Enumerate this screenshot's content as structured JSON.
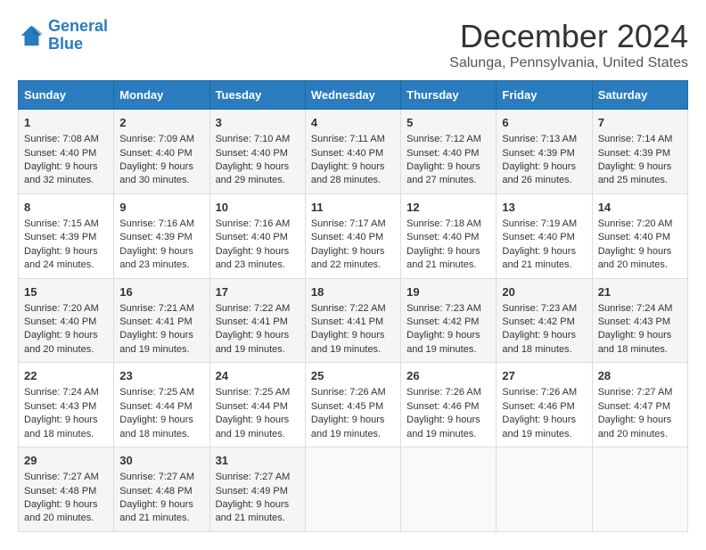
{
  "header": {
    "logo_line1": "General",
    "logo_line2": "Blue",
    "month": "December 2024",
    "location": "Salunga, Pennsylvania, United States"
  },
  "days_of_week": [
    "Sunday",
    "Monday",
    "Tuesday",
    "Wednesday",
    "Thursday",
    "Friday",
    "Saturday"
  ],
  "weeks": [
    [
      {
        "day": "1",
        "sunrise": "Sunrise: 7:08 AM",
        "sunset": "Sunset: 4:40 PM",
        "daylight": "Daylight: 9 hours and 32 minutes."
      },
      {
        "day": "2",
        "sunrise": "Sunrise: 7:09 AM",
        "sunset": "Sunset: 4:40 PM",
        "daylight": "Daylight: 9 hours and 30 minutes."
      },
      {
        "day": "3",
        "sunrise": "Sunrise: 7:10 AM",
        "sunset": "Sunset: 4:40 PM",
        "daylight": "Daylight: 9 hours and 29 minutes."
      },
      {
        "day": "4",
        "sunrise": "Sunrise: 7:11 AM",
        "sunset": "Sunset: 4:40 PM",
        "daylight": "Daylight: 9 hours and 28 minutes."
      },
      {
        "day": "5",
        "sunrise": "Sunrise: 7:12 AM",
        "sunset": "Sunset: 4:40 PM",
        "daylight": "Daylight: 9 hours and 27 minutes."
      },
      {
        "day": "6",
        "sunrise": "Sunrise: 7:13 AM",
        "sunset": "Sunset: 4:39 PM",
        "daylight": "Daylight: 9 hours and 26 minutes."
      },
      {
        "day": "7",
        "sunrise": "Sunrise: 7:14 AM",
        "sunset": "Sunset: 4:39 PM",
        "daylight": "Daylight: 9 hours and 25 minutes."
      }
    ],
    [
      {
        "day": "8",
        "sunrise": "Sunrise: 7:15 AM",
        "sunset": "Sunset: 4:39 PM",
        "daylight": "Daylight: 9 hours and 24 minutes."
      },
      {
        "day": "9",
        "sunrise": "Sunrise: 7:16 AM",
        "sunset": "Sunset: 4:39 PM",
        "daylight": "Daylight: 9 hours and 23 minutes."
      },
      {
        "day": "10",
        "sunrise": "Sunrise: 7:16 AM",
        "sunset": "Sunset: 4:40 PM",
        "daylight": "Daylight: 9 hours and 23 minutes."
      },
      {
        "day": "11",
        "sunrise": "Sunrise: 7:17 AM",
        "sunset": "Sunset: 4:40 PM",
        "daylight": "Daylight: 9 hours and 22 minutes."
      },
      {
        "day": "12",
        "sunrise": "Sunrise: 7:18 AM",
        "sunset": "Sunset: 4:40 PM",
        "daylight": "Daylight: 9 hours and 21 minutes."
      },
      {
        "day": "13",
        "sunrise": "Sunrise: 7:19 AM",
        "sunset": "Sunset: 4:40 PM",
        "daylight": "Daylight: 9 hours and 21 minutes."
      },
      {
        "day": "14",
        "sunrise": "Sunrise: 7:20 AM",
        "sunset": "Sunset: 4:40 PM",
        "daylight": "Daylight: 9 hours and 20 minutes."
      }
    ],
    [
      {
        "day": "15",
        "sunrise": "Sunrise: 7:20 AM",
        "sunset": "Sunset: 4:40 PM",
        "daylight": "Daylight: 9 hours and 20 minutes."
      },
      {
        "day": "16",
        "sunrise": "Sunrise: 7:21 AM",
        "sunset": "Sunset: 4:41 PM",
        "daylight": "Daylight: 9 hours and 19 minutes."
      },
      {
        "day": "17",
        "sunrise": "Sunrise: 7:22 AM",
        "sunset": "Sunset: 4:41 PM",
        "daylight": "Daylight: 9 hours and 19 minutes."
      },
      {
        "day": "18",
        "sunrise": "Sunrise: 7:22 AM",
        "sunset": "Sunset: 4:41 PM",
        "daylight": "Daylight: 9 hours and 19 minutes."
      },
      {
        "day": "19",
        "sunrise": "Sunrise: 7:23 AM",
        "sunset": "Sunset: 4:42 PM",
        "daylight": "Daylight: 9 hours and 19 minutes."
      },
      {
        "day": "20",
        "sunrise": "Sunrise: 7:23 AM",
        "sunset": "Sunset: 4:42 PM",
        "daylight": "Daylight: 9 hours and 18 minutes."
      },
      {
        "day": "21",
        "sunrise": "Sunrise: 7:24 AM",
        "sunset": "Sunset: 4:43 PM",
        "daylight": "Daylight: 9 hours and 18 minutes."
      }
    ],
    [
      {
        "day": "22",
        "sunrise": "Sunrise: 7:24 AM",
        "sunset": "Sunset: 4:43 PM",
        "daylight": "Daylight: 9 hours and 18 minutes."
      },
      {
        "day": "23",
        "sunrise": "Sunrise: 7:25 AM",
        "sunset": "Sunset: 4:44 PM",
        "daylight": "Daylight: 9 hours and 18 minutes."
      },
      {
        "day": "24",
        "sunrise": "Sunrise: 7:25 AM",
        "sunset": "Sunset: 4:44 PM",
        "daylight": "Daylight: 9 hours and 19 minutes."
      },
      {
        "day": "25",
        "sunrise": "Sunrise: 7:26 AM",
        "sunset": "Sunset: 4:45 PM",
        "daylight": "Daylight: 9 hours and 19 minutes."
      },
      {
        "day": "26",
        "sunrise": "Sunrise: 7:26 AM",
        "sunset": "Sunset: 4:46 PM",
        "daylight": "Daylight: 9 hours and 19 minutes."
      },
      {
        "day": "27",
        "sunrise": "Sunrise: 7:26 AM",
        "sunset": "Sunset: 4:46 PM",
        "daylight": "Daylight: 9 hours and 19 minutes."
      },
      {
        "day": "28",
        "sunrise": "Sunrise: 7:27 AM",
        "sunset": "Sunset: 4:47 PM",
        "daylight": "Daylight: 9 hours and 20 minutes."
      }
    ],
    [
      {
        "day": "29",
        "sunrise": "Sunrise: 7:27 AM",
        "sunset": "Sunset: 4:48 PM",
        "daylight": "Daylight: 9 hours and 20 minutes."
      },
      {
        "day": "30",
        "sunrise": "Sunrise: 7:27 AM",
        "sunset": "Sunset: 4:48 PM",
        "daylight": "Daylight: 9 hours and 21 minutes."
      },
      {
        "day": "31",
        "sunrise": "Sunrise: 7:27 AM",
        "sunset": "Sunset: 4:49 PM",
        "daylight": "Daylight: 9 hours and 21 minutes."
      },
      null,
      null,
      null,
      null
    ]
  ]
}
